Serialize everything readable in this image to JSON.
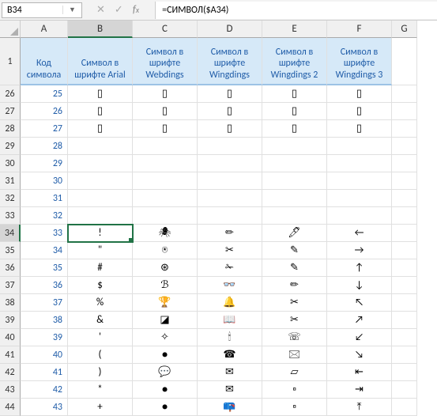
{
  "namebox": {
    "value": "B34"
  },
  "formula": {
    "value": "=СИМВОЛ($A34)"
  },
  "columns": [
    "A",
    "B",
    "C",
    "D",
    "E",
    "F",
    "G"
  ],
  "selectedColumn": "B",
  "headers": {
    "A": "Код символа",
    "B": "Символ в шрифте Arial",
    "C": "Символ в шрифте Webdings",
    "D": "Символ в шрифте Wingdings",
    "E": "Символ в шрифте Wingdings 2",
    "F": "Символ в шрифте Wingdings 3"
  },
  "rows": [
    {
      "n": 26,
      "code": "25",
      "b": "▯",
      "c": "▯",
      "d": "▯",
      "e": "▯",
      "f": "▯"
    },
    {
      "n": 27,
      "code": "26",
      "b": "▯",
      "c": "▯",
      "d": "▯",
      "e": "▯",
      "f": "▯"
    },
    {
      "n": 28,
      "code": "27",
      "b": "▯",
      "c": "▯",
      "d": "▯",
      "e": "▯",
      "f": "▯"
    },
    {
      "n": 29,
      "code": "28",
      "b": "",
      "c": "",
      "d": "",
      "e": "",
      "f": ""
    },
    {
      "n": 30,
      "code": "29",
      "b": "",
      "c": "",
      "d": "",
      "e": "",
      "f": ""
    },
    {
      "n": 31,
      "code": "30",
      "b": "",
      "c": "",
      "d": "",
      "e": "",
      "f": ""
    },
    {
      "n": 32,
      "code": "31",
      "b": "",
      "c": "",
      "d": "",
      "e": "",
      "f": ""
    },
    {
      "n": 33,
      "code": "32",
      "b": "",
      "c": "",
      "d": "",
      "e": "",
      "f": ""
    },
    {
      "n": 34,
      "code": "33",
      "b": "!",
      "c": "🕷",
      "d": "✏",
      "e": "🖊",
      "f": "←",
      "selected": true
    },
    {
      "n": 35,
      "code": "34",
      "b": "\"",
      "c": "⍟",
      "d": "✂",
      "e": "✎",
      "f": "→"
    },
    {
      "n": 36,
      "code": "35",
      "b": "#",
      "c": "⊛",
      "d": "✁",
      "e": "✎",
      "f": "↑"
    },
    {
      "n": 37,
      "code": "36",
      "b": "$",
      "c": "ℬ",
      "d": "👓",
      "e": "✏",
      "f": "↓"
    },
    {
      "n": 38,
      "code": "37",
      "b": "%",
      "c": "🏆",
      "d": "🔔",
      "e": "✂",
      "f": "↖"
    },
    {
      "n": 39,
      "code": "38",
      "b": "&",
      "c": "◪",
      "d": "📖",
      "e": "✂",
      "f": "↗"
    },
    {
      "n": 40,
      "code": "39",
      "b": "'",
      "c": "✧",
      "d": "🕯",
      "e": "☏",
      "f": "↙"
    },
    {
      "n": 41,
      "code": "40",
      "b": "(",
      "c": "●",
      "d": "☎",
      "e": "🖂",
      "f": "↘"
    },
    {
      "n": 42,
      "code": "41",
      "b": ")",
      "c": "💬",
      "d": "✉",
      "e": "▱",
      "f": "⇤"
    },
    {
      "n": 43,
      "code": "42",
      "b": "*",
      "c": "●",
      "d": "✉",
      "e": "▫",
      "f": "⇥"
    },
    {
      "n": 44,
      "code": "43",
      "b": "+",
      "c": "●",
      "d": "📪",
      "e": "▫",
      "f": "⤒"
    }
  ]
}
